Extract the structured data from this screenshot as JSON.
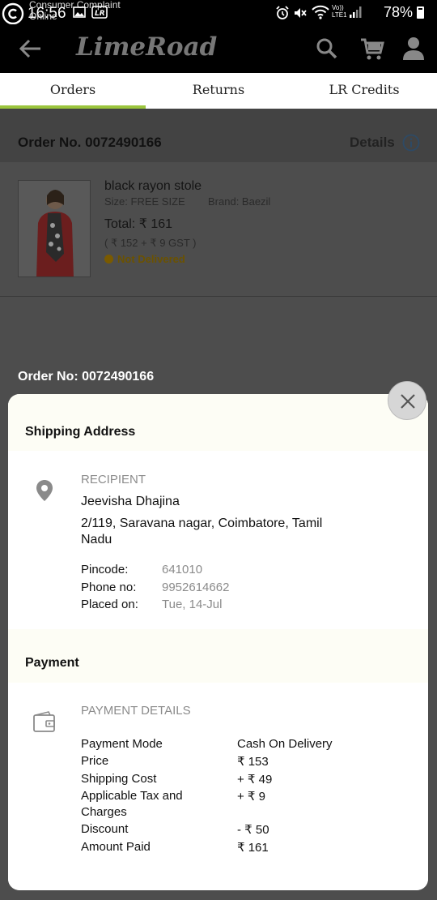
{
  "status_bar": {
    "time": "16:56",
    "notification_title": "Consumer Complaint",
    "notification_sub": "Online",
    "network_label": "LTE1",
    "battery": "78%"
  },
  "app_bar": {
    "brand": "LimeRoad"
  },
  "tabs": [
    {
      "label": "Orders",
      "active": true
    },
    {
      "label": "Returns",
      "active": false
    },
    {
      "label": "LR Credits",
      "active": false
    }
  ],
  "order": {
    "number_label": "Order No. 0072490166",
    "details_label": "Details",
    "product": {
      "name": "black rayon stole",
      "size": "Size: FREE SIZE",
      "brand": "Brand: Baezil",
      "total": "Total: ₹ 161",
      "breakup": "( ₹ 152 + ₹ 9 GST )",
      "status": "Not Delivered"
    }
  },
  "modal": {
    "order_no": "Order No: 0072490166",
    "shipping": {
      "title": "Shipping Address",
      "recipient_label": "RECIPIENT",
      "name": "Jeevisha Dhajina",
      "address_line1": "2/119, Saravana nagar, Coimbatore, Tamil",
      "address_line2": "Nadu",
      "pincode_label": "Pincode:",
      "pincode": "641010",
      "phone_label": "Phone no:",
      "phone": "9952614662",
      "placed_label": "Placed on:",
      "placed": "Tue, 14-Jul"
    },
    "payment": {
      "title": "Payment",
      "details_label": "PAYMENT DETAILS",
      "rows": [
        {
          "label": "Payment Mode",
          "value": "Cash On Delivery"
        },
        {
          "label": "Price",
          "value": "₹ 153"
        },
        {
          "label": "Shipping Cost",
          "value": "+ ₹ 49"
        },
        {
          "label": "Applicable Tax and",
          "label2": "Charges",
          "value": "+ ₹ 9"
        },
        {
          "label": "Discount",
          "value": "- ₹ 50"
        },
        {
          "label": "Amount Paid",
          "value": "₹ 161"
        }
      ]
    }
  },
  "colors": {
    "accent": "#9bc53d",
    "status_pending": "#f0b400"
  }
}
